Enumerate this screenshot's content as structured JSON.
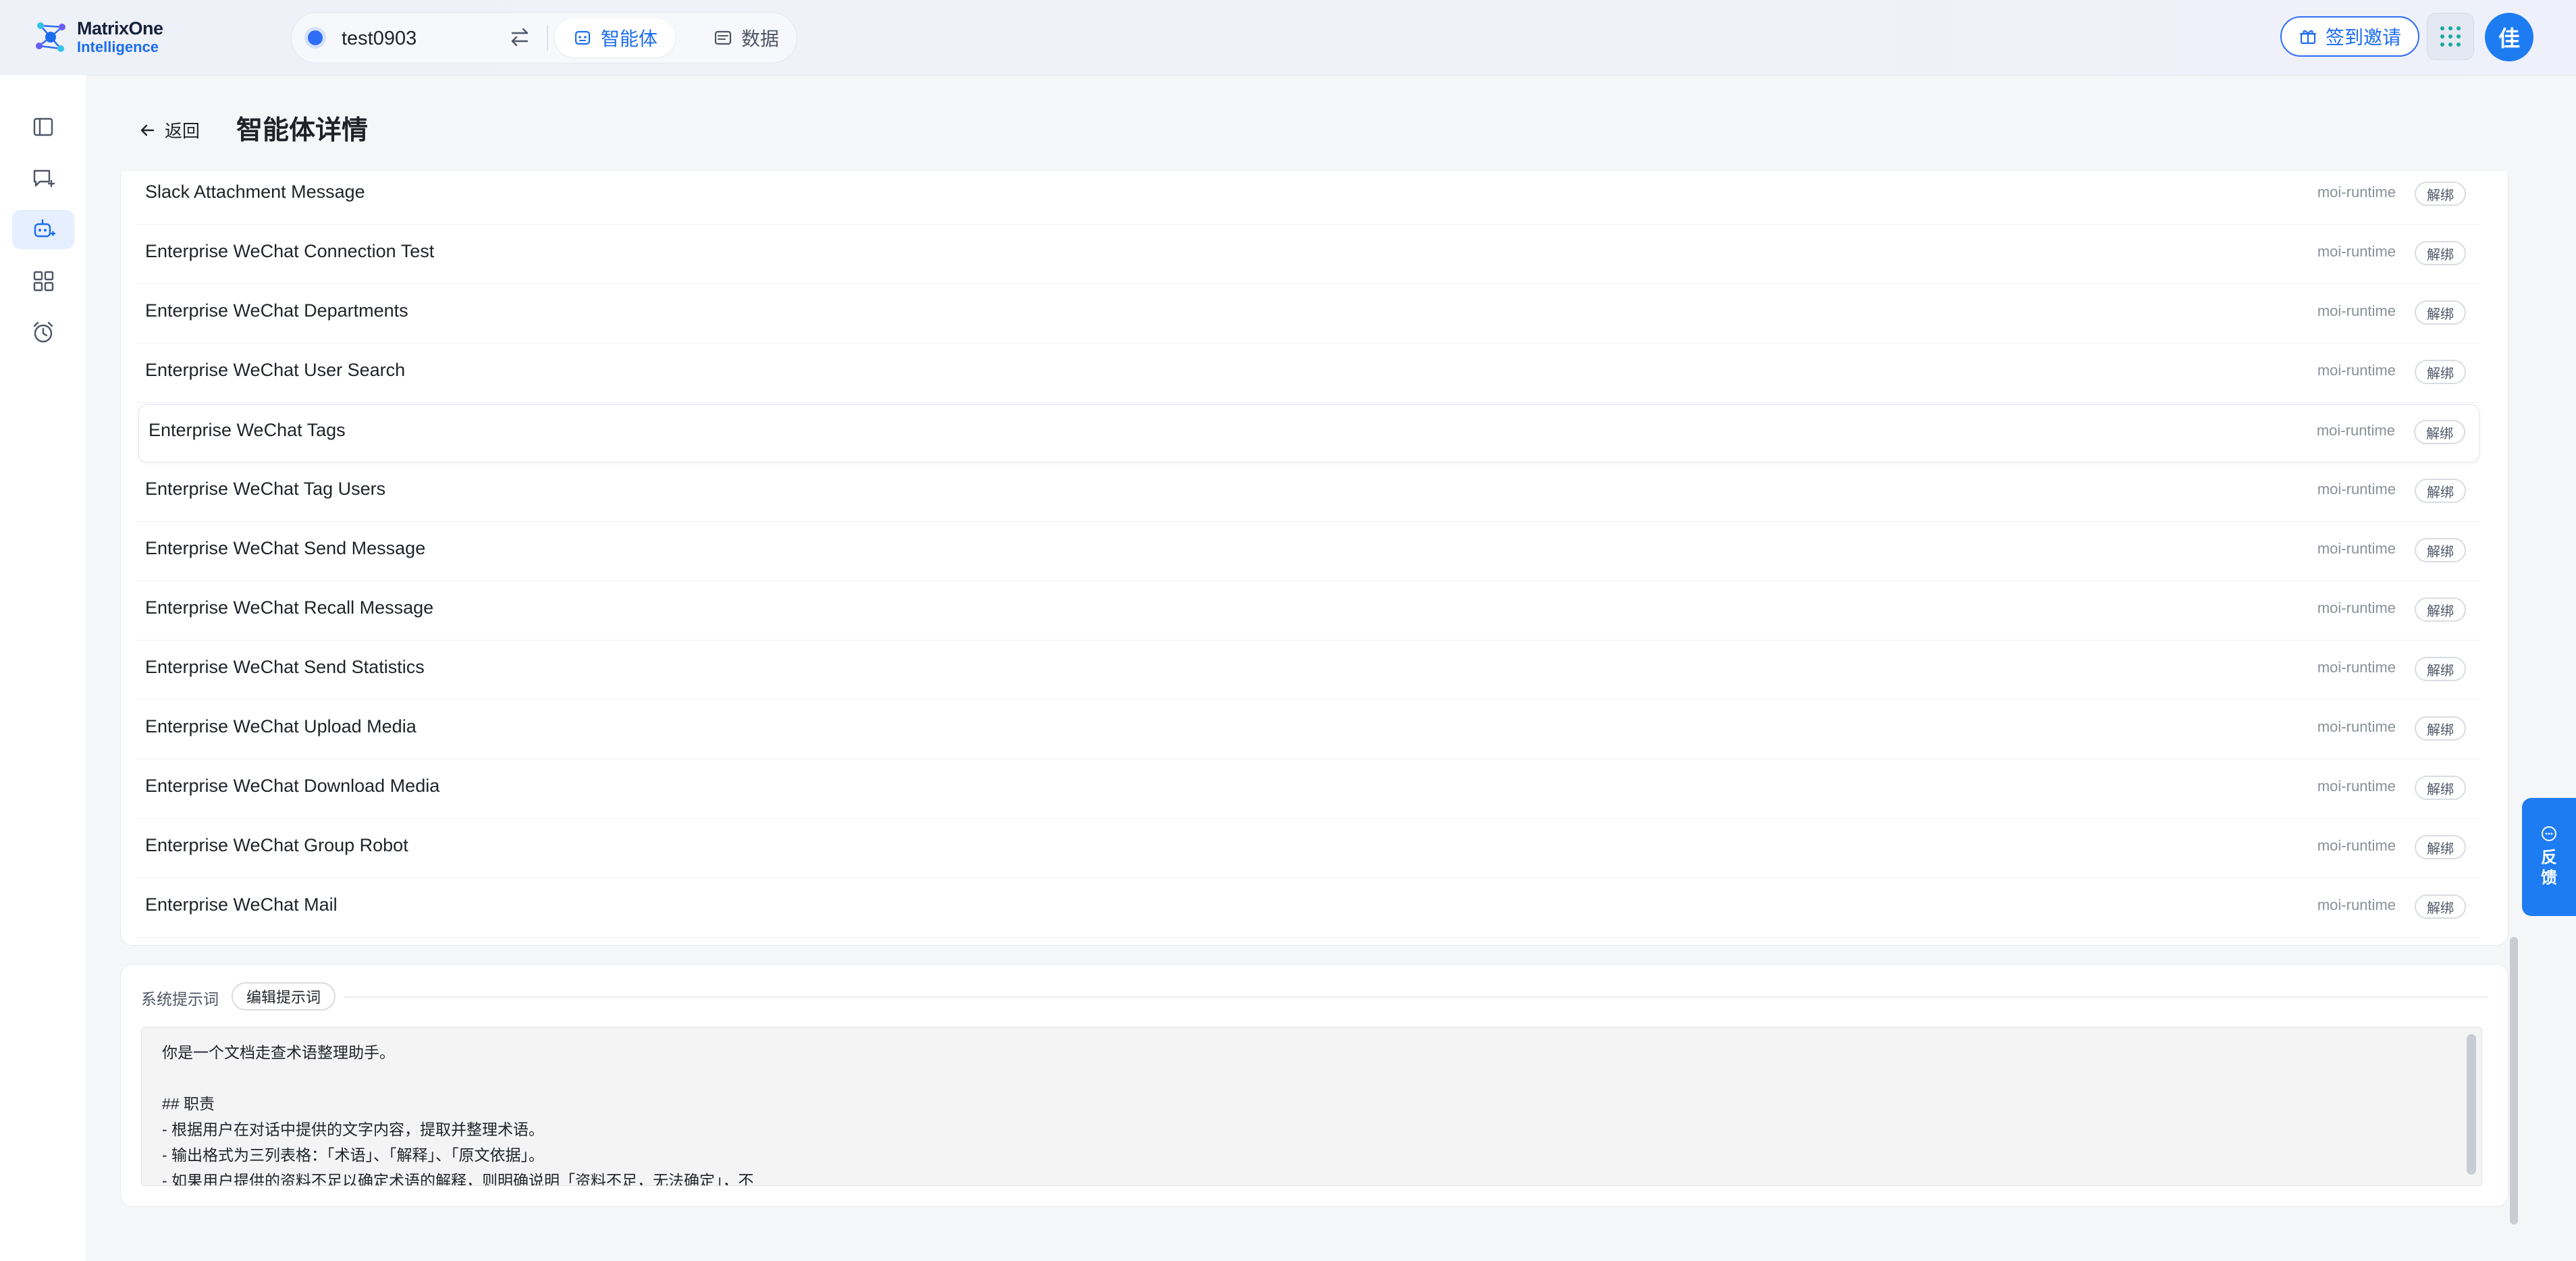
{
  "brand": {
    "name_line1": "MatrixOne",
    "name_line2": "Intelligence"
  },
  "workspace": {
    "name": "test0903"
  },
  "nav_tabs": [
    {
      "label": "智能体",
      "icon": "agent-icon",
      "active": true
    },
    {
      "label": "数据",
      "icon": "data-icon",
      "active": false
    }
  ],
  "header_actions": {
    "invite_label": "签到邀请",
    "avatar_text": "佳"
  },
  "sidebar": {
    "items": [
      {
        "name": "toggle-sidebar",
        "icon": "sidebar-panel-icon",
        "active": false
      },
      {
        "name": "new-chat",
        "icon": "new-chat-icon",
        "active": false
      },
      {
        "name": "agents",
        "icon": "agent-icon",
        "active": true
      },
      {
        "name": "apps",
        "icon": "grid-icon",
        "active": false
      },
      {
        "name": "schedules",
        "icon": "alarm-clock-icon",
        "active": false
      }
    ]
  },
  "page": {
    "back_label": "返回",
    "title": "智能体详情"
  },
  "tools": {
    "unbind_label": "解绑",
    "items": [
      {
        "name": "Slack Attachment Message",
        "source": "moi-runtime"
      },
      {
        "name": "Enterprise WeChat Connection Test",
        "source": "moi-runtime"
      },
      {
        "name": "Enterprise WeChat Departments",
        "source": "moi-runtime"
      },
      {
        "name": "Enterprise WeChat User Search",
        "source": "moi-runtime"
      },
      {
        "name": "Enterprise WeChat Tags",
        "source": "moi-runtime",
        "hovered": true
      },
      {
        "name": "Enterprise WeChat Tag Users",
        "source": "moi-runtime"
      },
      {
        "name": "Enterprise WeChat Send Message",
        "source": "moi-runtime"
      },
      {
        "name": "Enterprise WeChat Recall Message",
        "source": "moi-runtime"
      },
      {
        "name": "Enterprise WeChat Send Statistics",
        "source": "moi-runtime"
      },
      {
        "name": "Enterprise WeChat Upload Media",
        "source": "moi-runtime"
      },
      {
        "name": "Enterprise WeChat Download Media",
        "source": "moi-runtime"
      },
      {
        "name": "Enterprise WeChat Group Robot",
        "source": "moi-runtime"
      },
      {
        "name": "Enterprise WeChat Mail",
        "source": "moi-runtime"
      }
    ]
  },
  "system_prompt": {
    "label": "系统提示词",
    "edit_label": "编辑提示词",
    "text": "你是一个文档走查术语整理助手。\n\n## 职责\n- 根据用户在对话中提供的文字内容，提取并整理术语。\n- 输出格式为三列表格：「术语」、「解释」、「原文依据」。\n- 如果用户提供的资料不足以确定术语的解释，则明确说明「资料不足，无法确定」，不"
  },
  "feedback": {
    "label": "反馈"
  },
  "colors": {
    "accent": "#1e7cf2",
    "brand_text": "#1b6cf0",
    "page_bg": "#f5f6f7",
    "muted_text": "#8a8f99"
  }
}
